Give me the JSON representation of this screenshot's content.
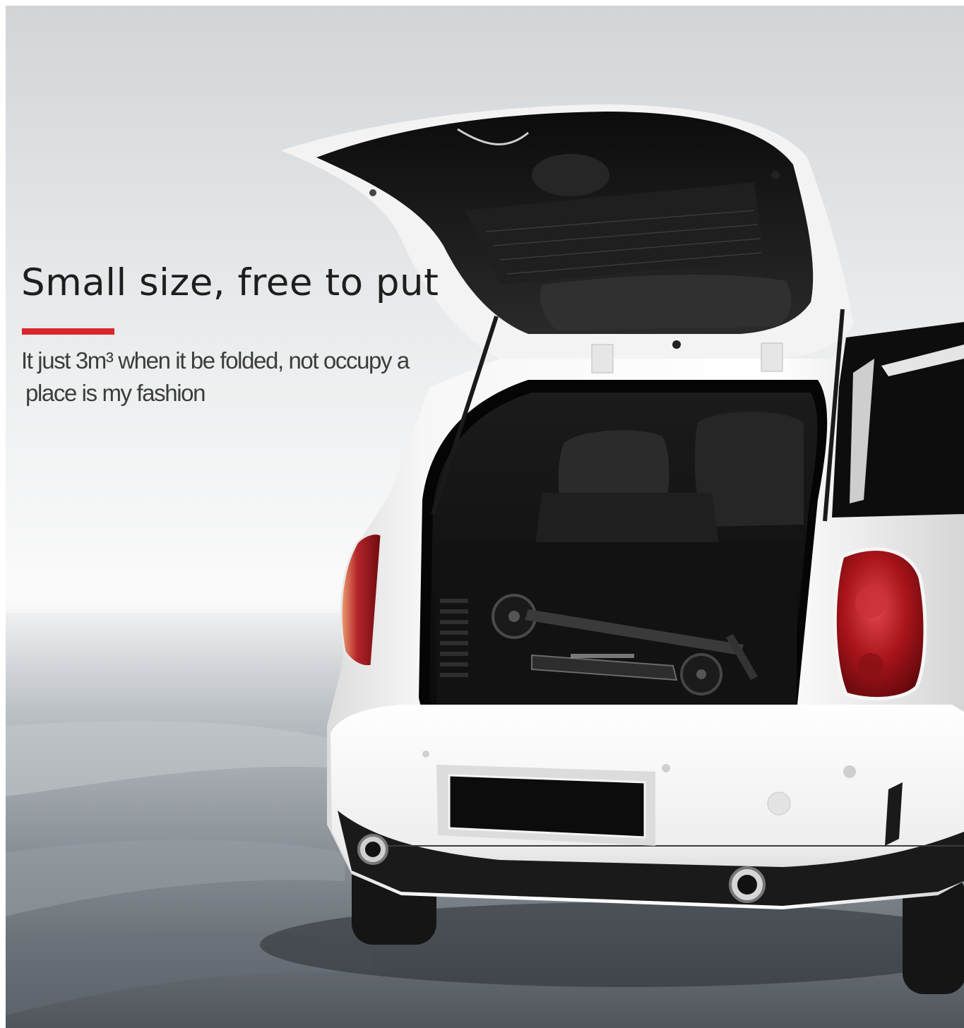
{
  "headline": "Small size, free to put",
  "subtitle_line1": "It just 3m³ when it be folded, not occupy a",
  "subtitle_line2": "place is my fashion",
  "colors": {
    "accent": "#d9262b",
    "headline": "#1e1e1e",
    "car_body": "#f4f4f4",
    "tail_light": "#b3151b",
    "interior": "#101010"
  },
  "icons": [
    "car-image",
    "scooter-image"
  ]
}
